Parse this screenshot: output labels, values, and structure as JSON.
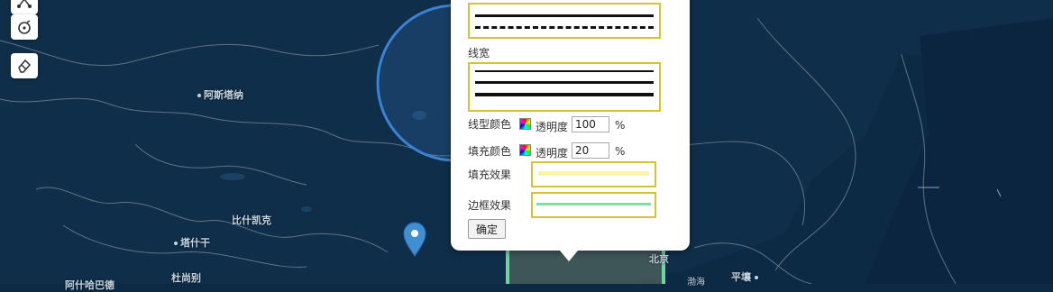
{
  "map": {
    "places": [
      {
        "name": "阿斯塔纳"
      },
      {
        "name": "比什凯克"
      },
      {
        "name": "塔什干"
      },
      {
        "name": "杜尚别"
      },
      {
        "name": "阿什哈巴德"
      },
      {
        "name": "北京"
      },
      {
        "name": "平壤"
      },
      {
        "name": "渤海"
      }
    ],
    "colors": {
      "circle": "#3b82d6",
      "marker": "#3f8fd2",
      "polygon_edge": "#6fd59a"
    }
  },
  "toolbar": {
    "icons": [
      "polyline-icon",
      "circle-draw-icon",
      "eraser-icon"
    ]
  },
  "style_panel": {
    "linewidth_label": "线宽",
    "stroke_color_label": "线型颜色",
    "stroke_opacity_label": "透明度",
    "stroke_opacity_value": "100",
    "stroke_unit": "%",
    "fill_color_label": "填充颜色",
    "fill_opacity_label": "透明度",
    "fill_opacity_value": "20",
    "fill_unit": "%",
    "fill_effect_label": "填充效果",
    "border_effect_label": "边框效果",
    "confirm_label": "确定",
    "colors": {
      "box_border": "#d4c237",
      "fill_preview": "#fbf6a0",
      "border_preview": "#7fe0a2"
    }
  }
}
